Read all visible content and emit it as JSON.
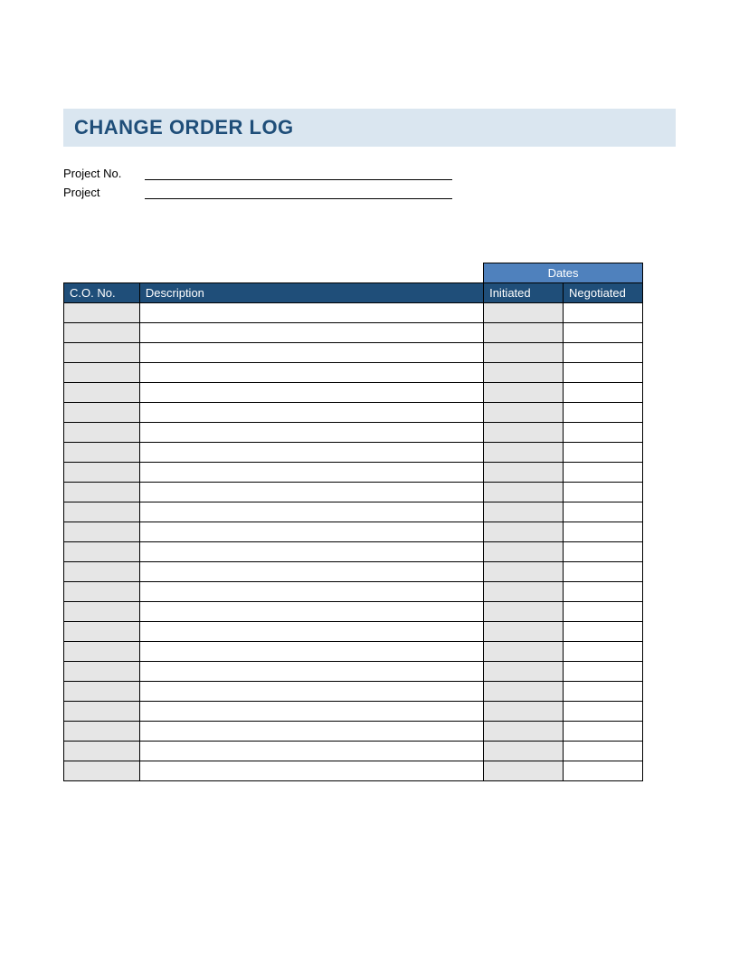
{
  "title": "CHANGE ORDER LOG",
  "meta": {
    "project_no_label": "Project No.",
    "project_no_value": "",
    "project_label": "Project",
    "project_value": ""
  },
  "table": {
    "group_header": "Dates",
    "headers": {
      "co_no": "C.O. No.",
      "description": "Description",
      "initiated": "Initiated",
      "negotiated": "Negotiated"
    },
    "rows": [
      {
        "co_no": "",
        "description": "",
        "initiated": "",
        "negotiated": ""
      },
      {
        "co_no": "",
        "description": "",
        "initiated": "",
        "negotiated": ""
      },
      {
        "co_no": "",
        "description": "",
        "initiated": "",
        "negotiated": ""
      },
      {
        "co_no": "",
        "description": "",
        "initiated": "",
        "negotiated": ""
      },
      {
        "co_no": "",
        "description": "",
        "initiated": "",
        "negotiated": ""
      },
      {
        "co_no": "",
        "description": "",
        "initiated": "",
        "negotiated": ""
      },
      {
        "co_no": "",
        "description": "",
        "initiated": "",
        "negotiated": ""
      },
      {
        "co_no": "",
        "description": "",
        "initiated": "",
        "negotiated": ""
      },
      {
        "co_no": "",
        "description": "",
        "initiated": "",
        "negotiated": ""
      },
      {
        "co_no": "",
        "description": "",
        "initiated": "",
        "negotiated": ""
      },
      {
        "co_no": "",
        "description": "",
        "initiated": "",
        "negotiated": ""
      },
      {
        "co_no": "",
        "description": "",
        "initiated": "",
        "negotiated": ""
      },
      {
        "co_no": "",
        "description": "",
        "initiated": "",
        "negotiated": ""
      },
      {
        "co_no": "",
        "description": "",
        "initiated": "",
        "negotiated": ""
      },
      {
        "co_no": "",
        "description": "",
        "initiated": "",
        "negotiated": ""
      },
      {
        "co_no": "",
        "description": "",
        "initiated": "",
        "negotiated": ""
      },
      {
        "co_no": "",
        "description": "",
        "initiated": "",
        "negotiated": ""
      },
      {
        "co_no": "",
        "description": "",
        "initiated": "",
        "negotiated": ""
      },
      {
        "co_no": "",
        "description": "",
        "initiated": "",
        "negotiated": ""
      },
      {
        "co_no": "",
        "description": "",
        "initiated": "",
        "negotiated": ""
      },
      {
        "co_no": "",
        "description": "",
        "initiated": "",
        "negotiated": ""
      },
      {
        "co_no": "",
        "description": "",
        "initiated": "",
        "negotiated": ""
      },
      {
        "co_no": "",
        "description": "",
        "initiated": "",
        "negotiated": ""
      },
      {
        "co_no": "",
        "description": "",
        "initiated": "",
        "negotiated": ""
      }
    ]
  }
}
